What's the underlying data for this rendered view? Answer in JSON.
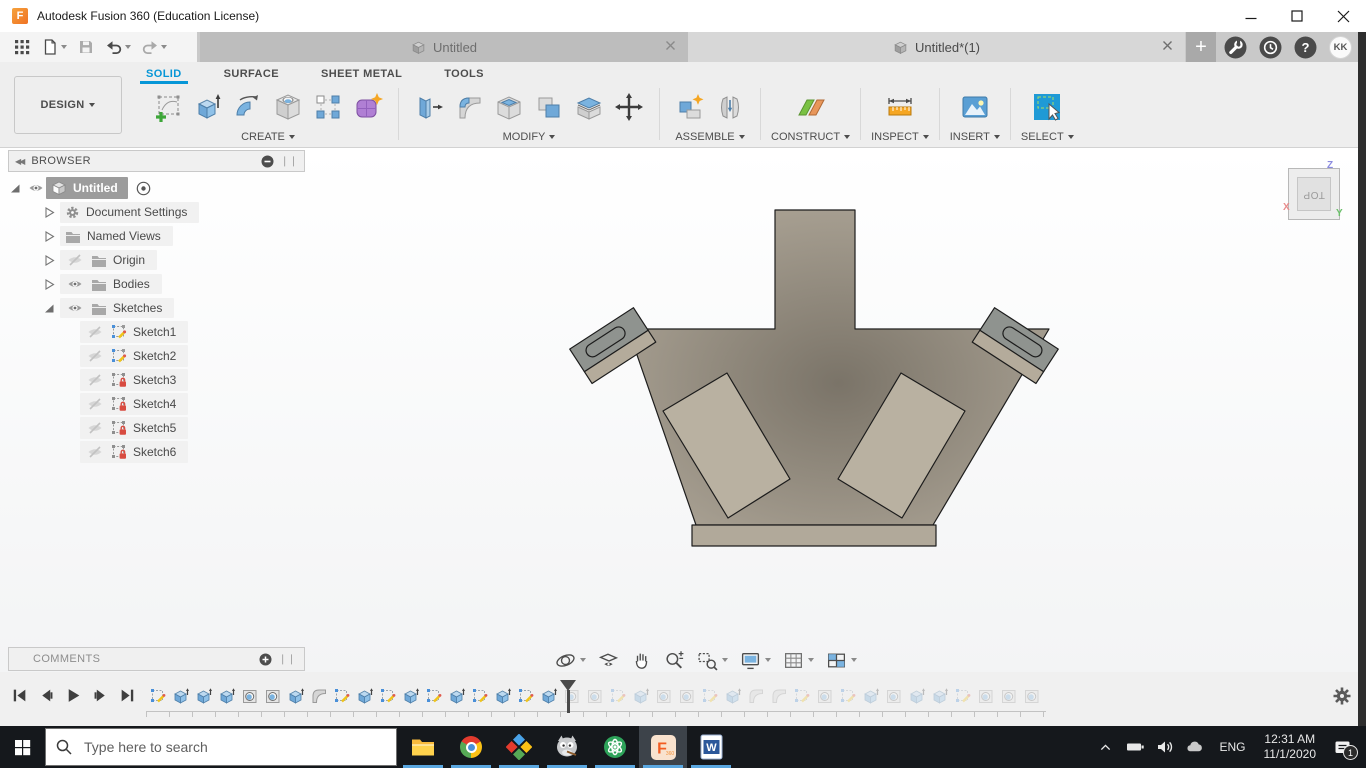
{
  "window": {
    "title": "Autodesk Fusion 360 (Education License)",
    "controls": [
      "minimize",
      "maximize",
      "close"
    ]
  },
  "quick_access": {
    "icons": [
      {
        "name": "app-grid",
        "dropdown": false,
        "disabled": false
      },
      {
        "name": "new-file",
        "dropdown": true,
        "disabled": false
      },
      {
        "name": "save",
        "dropdown": false,
        "disabled": true
      },
      {
        "name": "undo",
        "dropdown": true,
        "disabled": false
      },
      {
        "name": "redo",
        "dropdown": true,
        "disabled": true
      }
    ]
  },
  "tabbar": {
    "tabs": [
      {
        "label": "Untitled",
        "active": false
      },
      {
        "label": "Untitled*(1)",
        "active": true
      }
    ],
    "new_tab_label": "+",
    "right_icons": [
      "job-status",
      "notification-center",
      "help"
    ],
    "avatar_initials": "KK"
  },
  "ribbon": {
    "design_label": "DESIGN",
    "tabs": [
      {
        "label": "SOLID",
        "active": true
      },
      {
        "label": "SURFACE",
        "active": false
      },
      {
        "label": "SHEET METAL",
        "active": false
      },
      {
        "label": "TOOLS",
        "active": false
      }
    ],
    "groups": [
      {
        "label": "CREATE",
        "icons": [
          "create-sketch",
          "extrude",
          "revolve",
          "hole",
          "rectangular-pattern",
          "create-form"
        ]
      },
      {
        "label": "MODIFY",
        "icons": [
          "press-pull",
          "fillet",
          "shell",
          "combine",
          "split-body",
          "move-copy"
        ]
      },
      {
        "label": "ASSEMBLE",
        "icons": [
          "new-component",
          "joint"
        ]
      },
      {
        "label": "CONSTRUCT",
        "icons": [
          "construct-plane"
        ]
      },
      {
        "label": "INSPECT",
        "icons": [
          "measure"
        ]
      },
      {
        "label": "INSERT",
        "icons": [
          "insert-image"
        ]
      },
      {
        "label": "SELECT",
        "icons": [
          "select"
        ]
      }
    ]
  },
  "browser": {
    "header": "BROWSER",
    "root": {
      "label": "Untitled",
      "visible": true,
      "selected": true
    },
    "children": [
      {
        "label": "Document Settings",
        "icon": "gear",
        "eye": "none",
        "expanded": false
      },
      {
        "label": "Named Views",
        "icon": "folder",
        "eye": "none",
        "expanded": false
      },
      {
        "label": "Origin",
        "icon": "folder",
        "eye": "off",
        "expanded": false
      },
      {
        "label": "Bodies",
        "icon": "folder",
        "eye": "on",
        "expanded": false
      },
      {
        "label": "Sketches",
        "icon": "folder",
        "eye": "on",
        "expanded": true
      }
    ],
    "sketches": [
      {
        "label": "Sketch1",
        "state": "editable"
      },
      {
        "label": "Sketch2",
        "state": "editable"
      },
      {
        "label": "Sketch3",
        "state": "locked"
      },
      {
        "label": "Sketch4",
        "state": "locked"
      },
      {
        "label": "Sketch5",
        "state": "locked"
      },
      {
        "label": "Sketch6",
        "state": "locked"
      }
    ],
    "comments_label": "COMMENTS"
  },
  "viewcube": {
    "face_label": "TOP",
    "axis_labels": {
      "x": "X",
      "y": "Y",
      "z": "Z"
    }
  },
  "navbar": {
    "buttons": [
      {
        "icon": "orbit",
        "dropdown": true
      },
      {
        "icon": "look-at",
        "dropdown": false
      },
      {
        "icon": "pan",
        "dropdown": false
      },
      {
        "icon": "zoom",
        "dropdown": false
      },
      {
        "icon": "window-zoom",
        "dropdown": true
      },
      {
        "icon": "display-settings",
        "dropdown": true
      },
      {
        "icon": "grid-display",
        "dropdown": true
      },
      {
        "icon": "viewports",
        "dropdown": true
      }
    ]
  },
  "timeline": {
    "playback": [
      "go-to-start",
      "step-back",
      "play",
      "step-forward",
      "go-to-end"
    ],
    "features": [
      "sketch",
      "extrude",
      "extrude",
      "extrude",
      "hole",
      "hole",
      "extrude",
      "fillet",
      "sketch",
      "extrude",
      "sketch",
      "extrude",
      "sketch",
      "extrude",
      "sketch",
      "extrude",
      "sketch",
      "extrude",
      "hole",
      "hole",
      "sketch",
      "extrude",
      "hole",
      "hole",
      "sketch",
      "extrude",
      "fillet",
      "fillet",
      "sketch",
      "hole",
      "sketch",
      "extrude",
      "hole",
      "extrude",
      "extrude",
      "sketch",
      "hole",
      "hole",
      "hole"
    ],
    "completed_count": 18,
    "settings_icon": "gear"
  },
  "taskbar": {
    "search_placeholder": "Type here to search",
    "apps": [
      {
        "name": "file-explorer",
        "active": false
      },
      {
        "name": "chrome",
        "active": false
      },
      {
        "name": "photo-editor-app",
        "active": false
      },
      {
        "name": "gimp",
        "active": false
      },
      {
        "name": "green-orbit-app",
        "active": false
      },
      {
        "name": "fusion-360",
        "active": true
      },
      {
        "name": "word",
        "active": false
      }
    ],
    "tray": {
      "language": "ENG",
      "time": "12:31 AM",
      "date": "11/1/2020",
      "notification_badge": "1",
      "icons": [
        "hidden-icons",
        "battery",
        "volume",
        "onedrive"
      ]
    }
  },
  "colors": {
    "accent_blue": "#0696d7",
    "model_tan": "#aaa293",
    "taskbar_bg": "#15181c"
  }
}
